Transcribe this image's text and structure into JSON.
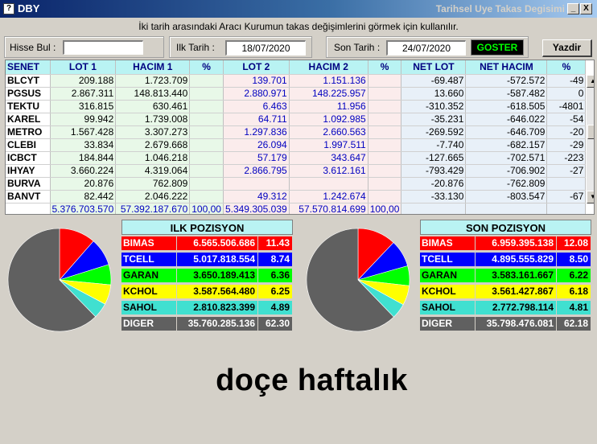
{
  "window": {
    "app_name": "DBY",
    "title": "Tarihsel Uye Takas Degisimi",
    "sys_icon": "?",
    "minimize": "_",
    "close": "X"
  },
  "instruction": "İki tarih arasındaki  Aracı Kurumun takas değişimlerini görmek için kullanılır.",
  "filters": {
    "hisse_label": "Hisse Bul :",
    "hisse_value": "",
    "ilk_label": "Ilk Tarih :",
    "ilk_value": "18/07/2020",
    "son_label": "Son Tarih :",
    "son_value": "24/07/2020",
    "goster_label": "GOSTER",
    "yazdir_label": "Yazdir"
  },
  "grid": {
    "columns": [
      "SENET",
      "LOT 1",
      "HACIM 1",
      "%",
      "LOT 2",
      "HACIM 2",
      "%",
      "NET LOT",
      "NET HACIM",
      "%"
    ],
    "rows": [
      [
        "BLCYT",
        "209.188",
        "1.723.709",
        "",
        "139.701",
        "1.151.136",
        "",
        "-69.487",
        "-572.572",
        "-49"
      ],
      [
        "PGSUS",
        "2.867.311",
        "148.813.440",
        "",
        "2.880.971",
        "148.225.957",
        "",
        "13.660",
        "-587.482",
        "0"
      ],
      [
        "TEKTU",
        "316.815",
        "630.461",
        "",
        "6.463",
        "11.956",
        "",
        "-310.352",
        "-618.505",
        "-4801"
      ],
      [
        "KAREL",
        "99.942",
        "1.739.008",
        "",
        "64.711",
        "1.092.985",
        "",
        "-35.231",
        "-646.022",
        "-54"
      ],
      [
        "METRO",
        "1.567.428",
        "3.307.273",
        "",
        "1.297.836",
        "2.660.563",
        "",
        "-269.592",
        "-646.709",
        "-20"
      ],
      [
        "CLEBI",
        "33.834",
        "2.679.668",
        "",
        "26.094",
        "1.997.511",
        "",
        "-7.740",
        "-682.157",
        "-29"
      ],
      [
        "ICBCT",
        "184.844",
        "1.046.218",
        "",
        "57.179",
        "343.647",
        "",
        "-127.665",
        "-702.571",
        "-223"
      ],
      [
        "IHYAY",
        "3.660.224",
        "4.319.064",
        "",
        "2.866.795",
        "3.612.161",
        "",
        "-793.429",
        "-706.902",
        "-27"
      ],
      [
        "BURVA",
        "20.876",
        "762.809",
        "",
        "",
        "",
        "",
        "-20.876",
        "-762.809",
        ""
      ],
      [
        "BANVT",
        "82.442",
        "2.046.222",
        "",
        "49.312",
        "1.242.674",
        "",
        "-33.130",
        "-803.547",
        "-67"
      ]
    ],
    "totals": [
      "",
      "5.376.703.570",
      "57.392.187.670",
      "100,00",
      "5.349.305.039",
      "57.570.814.699",
      "100,00",
      "",
      "",
      ""
    ]
  },
  "ilk_pozisyon": {
    "title": "ILK POZISYON",
    "rows": [
      {
        "name": "BIMAS",
        "value": "6.565.506.686",
        "pct": "11.43",
        "share": 11.43,
        "color": "#ff0000",
        "text": "#ffffff"
      },
      {
        "name": "TCELL",
        "value": "5.017.818.554",
        "pct": "8.74",
        "share": 8.74,
        "color": "#0000ff",
        "text": "#ffffff"
      },
      {
        "name": "GARAN",
        "value": "3.650.189.413",
        "pct": "6.36",
        "share": 6.36,
        "color": "#00ff00",
        "text": "#000000"
      },
      {
        "name": "KCHOL",
        "value": "3.587.564.480",
        "pct": "6.25",
        "share": 6.25,
        "color": "#ffff00",
        "text": "#000000"
      },
      {
        "name": "SAHOL",
        "value": "2.810.823.399",
        "pct": "4.89",
        "share": 4.89,
        "color": "#40e0d0",
        "text": "#000000"
      },
      {
        "name": "DIGER",
        "value": "35.760.285.136",
        "pct": "62.30",
        "share": 62.3,
        "color": "#606060",
        "text": "#ffffff"
      }
    ]
  },
  "son_pozisyon": {
    "title": "SON POZISYON",
    "rows": [
      {
        "name": "BIMAS",
        "value": "6.959.395.138",
        "pct": "12.08",
        "share": 12.08,
        "color": "#ff0000",
        "text": "#ffffff"
      },
      {
        "name": "TCELL",
        "value": "4.895.555.829",
        "pct": "8.50",
        "share": 8.5,
        "color": "#0000ff",
        "text": "#ffffff"
      },
      {
        "name": "GARAN",
        "value": "3.583.161.667",
        "pct": "6.22",
        "share": 6.22,
        "color": "#00ff00",
        "text": "#000000"
      },
      {
        "name": "KCHOL",
        "value": "3.561.427.867",
        "pct": "6.18",
        "share": 6.18,
        "color": "#ffff00",
        "text": "#000000"
      },
      {
        "name": "SAHOL",
        "value": "2.772.798.114",
        "pct": "4.81",
        "share": 4.81,
        "color": "#40e0d0",
        "text": "#000000"
      },
      {
        "name": "DIGER",
        "value": "35.798.476.081",
        "pct": "62.18",
        "share": 62.18,
        "color": "#606060",
        "text": "#ffffff"
      }
    ]
  },
  "footer_text": "doçe haftalık"
}
